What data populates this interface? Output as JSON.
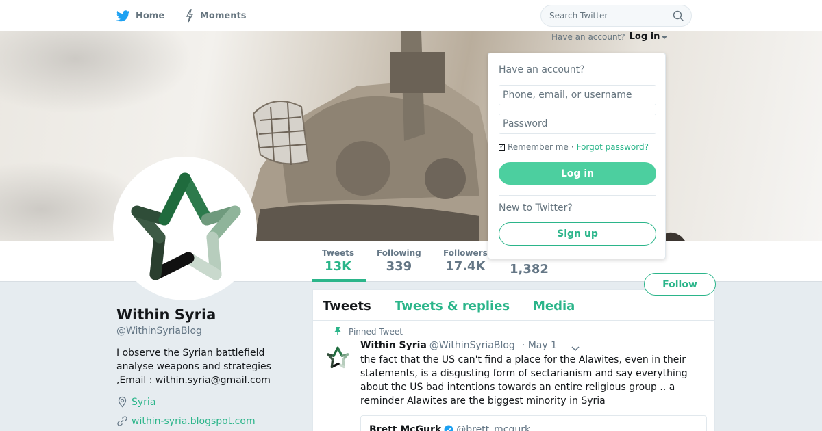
{
  "nav": {
    "home_label": "Home",
    "moments_label": "Moments",
    "search_placeholder": "Search Twitter"
  },
  "login_hint": {
    "text": "Have an account?",
    "link": "Log in"
  },
  "login_panel": {
    "title": "Have an account?",
    "username_placeholder": "Phone, email, or username",
    "password_placeholder": "Password",
    "remember_label": "Remember me",
    "separator": "·",
    "forgot_label": "Forgot password?",
    "login_button": "Log in",
    "new_text": "New to Twitter?",
    "signup_button": "Sign up"
  },
  "stats": [
    {
      "label": "Tweets",
      "value": "13K"
    },
    {
      "label": "Following",
      "value": "339"
    },
    {
      "label": "Followers",
      "value": "17.4K"
    },
    {
      "label": "",
      "value": "1,382"
    }
  ],
  "follow_button": "Follow",
  "profile": {
    "name": "Within Syria",
    "handle": "@WithinSyriaBlog",
    "bio": "I observe the Syrian battlefield analyse weapons and strategies ,Email : within.syria@gmail.com",
    "location": "Syria",
    "url": "within-syria.blogspot.com"
  },
  "timeline": {
    "tabs": [
      "Tweets",
      "Tweets & replies",
      "Media"
    ],
    "pinned_label": "Pinned Tweet",
    "tweet": {
      "name": "Within Syria",
      "handle": "@WithinSyriaBlog",
      "date": "· May 1",
      "text": "the fact that the US can't find a place for the Alawites, even in their statements, is a disgusting form of sectarianism and say everything about the US bad intentions towards an entire religious group  .. a reminder Alawites are the biggest minority in Syria"
    },
    "quote": {
      "name": "Brett McGurk",
      "handle": "@brett_mcgurk"
    }
  },
  "colors": {
    "accent": "#2bb58a",
    "login_button_bg": "#4ccf9f",
    "twitter_blue": "#1da1f2"
  }
}
